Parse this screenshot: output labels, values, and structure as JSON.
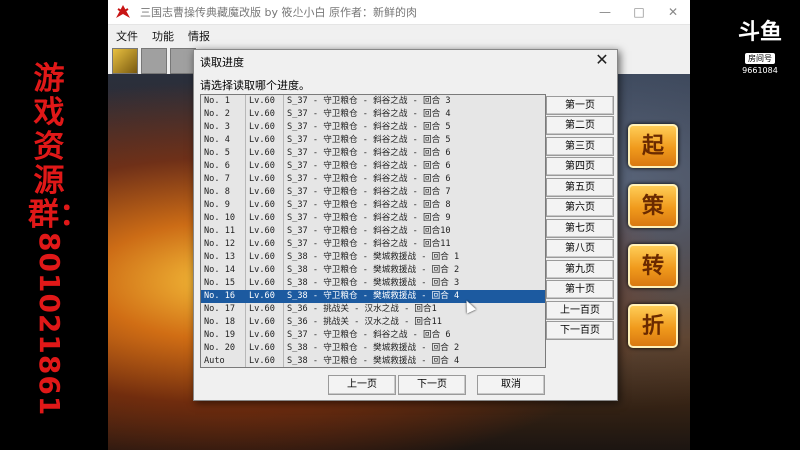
{
  "overlay": {
    "side_text_cn": "游戏资源群：",
    "side_text_num": "801021861",
    "logo_text": "斗鱼",
    "logo_tag": "房间号",
    "room_id": "9661084"
  },
  "window": {
    "title": "三国志曹操传典藏魔改版  by 筱尐小白  原作者：新鲜的肉",
    "minimize_icon": "minimize-icon",
    "maximize_icon": "maximize-icon",
    "close_icon": "close-icon"
  },
  "menu": [
    "文件",
    "功能",
    "情报"
  ],
  "game_buttons": [
    "起",
    "策",
    "转",
    "折"
  ],
  "dialog": {
    "title": "读取进度",
    "prompt": "请选择读取哪个进度。",
    "rows": [
      {
        "no": "No.  1",
        "lv": "Lv.60",
        "desc": "S_37 - 守卫粮仓 - 斜谷之战 - 回合 3"
      },
      {
        "no": "No.  2",
        "lv": "Lv.60",
        "desc": "S_37 - 守卫粮仓 - 斜谷之战 - 回合 4"
      },
      {
        "no": "No.  3",
        "lv": "Lv.60",
        "desc": "S_37 - 守卫粮仓 - 斜谷之战 - 回合 5"
      },
      {
        "no": "No.  4",
        "lv": "Lv.60",
        "desc": "S_37 - 守卫粮仓 - 斜谷之战 - 回合 5"
      },
      {
        "no": "No.  5",
        "lv": "Lv.60",
        "desc": "S_37 - 守卫粮仓 - 斜谷之战 - 回合 6"
      },
      {
        "no": "No.  6",
        "lv": "Lv.60",
        "desc": "S_37 - 守卫粮仓 - 斜谷之战 - 回合 6"
      },
      {
        "no": "No.  7",
        "lv": "Lv.60",
        "desc": "S_37 - 守卫粮仓 - 斜谷之战 - 回合 6"
      },
      {
        "no": "No.  8",
        "lv": "Lv.60",
        "desc": "S_37 - 守卫粮仓 - 斜谷之战 - 回合 7"
      },
      {
        "no": "No.  9",
        "lv": "Lv.60",
        "desc": "S_37 - 守卫粮仓 - 斜谷之战 - 回合 8"
      },
      {
        "no": "No. 10",
        "lv": "Lv.60",
        "desc": "S_37 - 守卫粮仓 - 斜谷之战 - 回合 9"
      },
      {
        "no": "No. 11",
        "lv": "Lv.60",
        "desc": "S_37 - 守卫粮仓 - 斜谷之战 - 回合10"
      },
      {
        "no": "No. 12",
        "lv": "Lv.60",
        "desc": "S_37 - 守卫粮仓 - 斜谷之战 - 回合11"
      },
      {
        "no": "No. 13",
        "lv": "Lv.60",
        "desc": "S_38 - 守卫粮仓 - 樊城救援战 - 回合 1"
      },
      {
        "no": "No. 14",
        "lv": "Lv.60",
        "desc": "S_38 - 守卫粮仓 - 樊城救援战 - 回合 2"
      },
      {
        "no": "No. 15",
        "lv": "Lv.60",
        "desc": "S_38 - 守卫粮仓 - 樊城救援战 - 回合 3"
      },
      {
        "no": "No. 16",
        "lv": "Lv.60",
        "desc": "S_38 - 守卫粮仓 - 樊城救援战 - 回合 4"
      },
      {
        "no": "No. 17",
        "lv": "Lv.60",
        "desc": "S_36 - 挑战关 - 汉水之战 - 回合1"
      },
      {
        "no": "No. 18",
        "lv": "Lv.60",
        "desc": "S_36 - 挑战关 - 汉水之战 - 回合11"
      },
      {
        "no": "No. 19",
        "lv": "Lv.60",
        "desc": "S_37 - 守卫粮仓 - 斜谷之战 - 回合 6"
      },
      {
        "no": "No. 20",
        "lv": "Lv.60",
        "desc": "S_38 - 守卫粮仓 - 樊城救援战 - 回合 2"
      },
      {
        "no": "Auto",
        "lv": "Lv.60",
        "desc": "S_38 - 守卫粮仓 - 樊城救援战 - 回合 4"
      }
    ],
    "selected_index": 15,
    "page_buttons": [
      "第一页",
      "第二页",
      "第三页",
      "第四页",
      "第五页",
      "第六页",
      "第七页",
      "第八页",
      "第九页",
      "第十页",
      "上一百页",
      "下一百页"
    ],
    "prev_label": "上一页",
    "next_label": "下一页",
    "cancel_label": "取消",
    "selection_color": "#1c5aa0"
  }
}
